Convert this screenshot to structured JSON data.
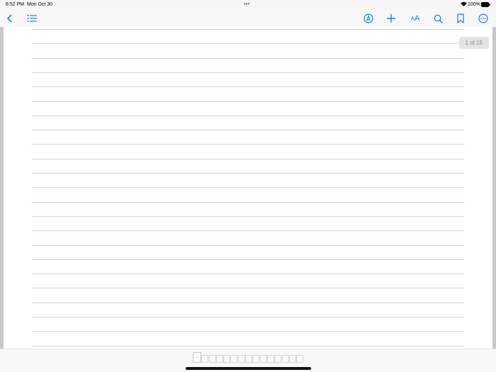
{
  "status": {
    "time": "8:52 PM",
    "date": "Mon Oct 30",
    "battery": "100%"
  },
  "toolbar": {
    "icons": [
      "back-icon",
      "list-icon",
      "markup-icon",
      "plus-icon",
      "text-size-icon",
      "search-icon",
      "bookmark-icon",
      "more-icon"
    ],
    "accent": "#1a7cf5",
    "text_size_label": "AA"
  },
  "document": {
    "page_counter": "1 of 15",
    "current_page": 1,
    "total_pages": 15,
    "ruled_lines": 23
  }
}
